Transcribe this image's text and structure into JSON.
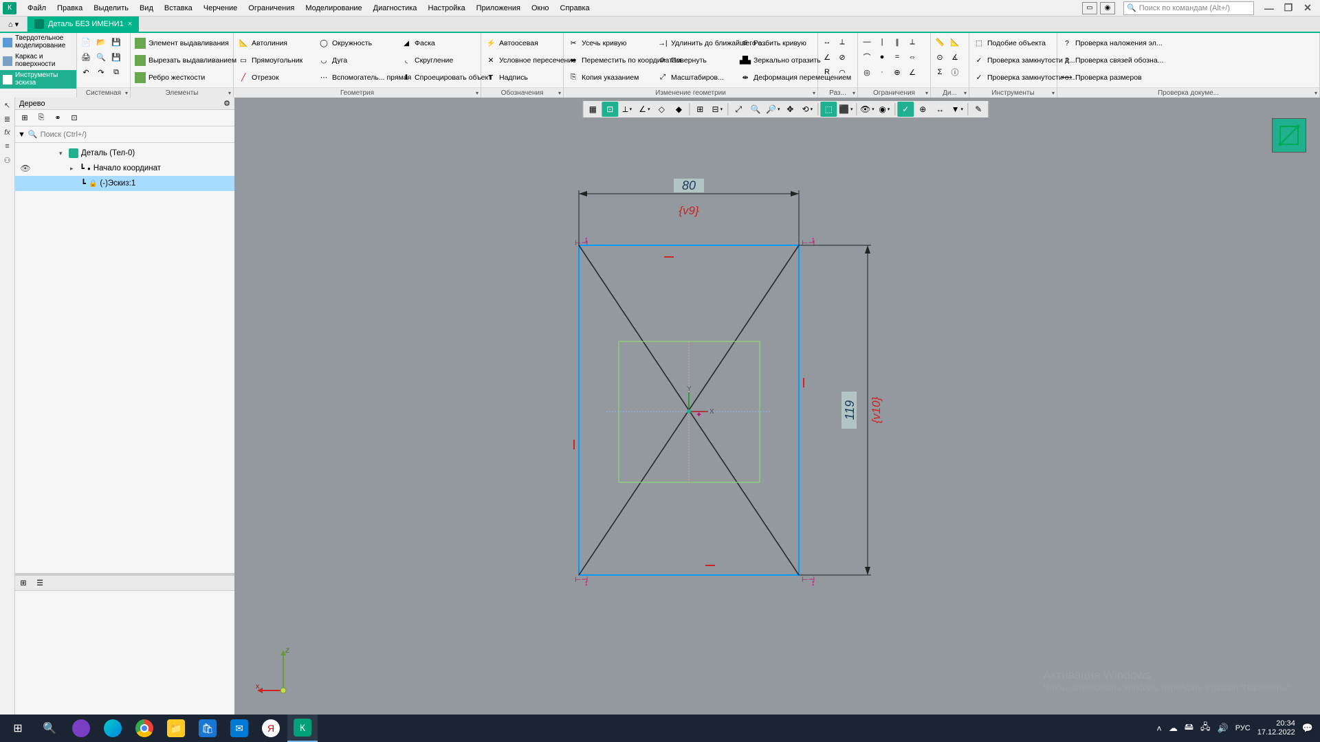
{
  "menu": [
    "Файл",
    "Правка",
    "Выделить",
    "Вид",
    "Вставка",
    "Черчение",
    "Ограничения",
    "Моделирование",
    "Диагностика",
    "Настройка",
    "Приложения",
    "Окно",
    "Справка"
  ],
  "search_placeholder": "Поиск по командам (Alt+/)",
  "tab": {
    "home": "⌂ ▾",
    "doc_name": "Деталь БЕЗ ИМЕНИ1"
  },
  "modes": [
    {
      "label": "Твердотельное моделирование"
    },
    {
      "label": "Каркас и поверхности"
    },
    {
      "label": "Инструменты эскиза",
      "active": true
    }
  ],
  "ribbon": {
    "system": {
      "label": "Системная"
    },
    "elements": {
      "label": "Элементы",
      "items": [
        "Элемент выдавливания",
        "Вырезать выдавливанием",
        "Ребро жесткости"
      ]
    },
    "geometry": {
      "label": "Геометрия",
      "col1": [
        "Автолиния",
        "Прямоугольник",
        "Отрезок"
      ],
      "col2": [
        "Окружность",
        "Дуга",
        "Вспомогатель... прямая"
      ],
      "col3": [
        "Фаска",
        "Скругление",
        "Спроецировать объект"
      ]
    },
    "annotate": {
      "label": "Обозначения",
      "items": [
        "Автоосевая",
        "Условное пересечение",
        "Надпись"
      ]
    },
    "edit_geom": {
      "label": "Изменение геометрии",
      "col1": [
        "Усечь кривую",
        "Переместить по координатам",
        "Копия указанием"
      ],
      "col2": [
        "Удлинить до ближайшего о...",
        "Повернуть",
        "Масштабиров..."
      ],
      "col3": [
        "Разбить кривую",
        "Зеркально отразить",
        "Деформация перемещением"
      ]
    },
    "dims": {
      "label": "Раз..."
    },
    "constraints": {
      "label": "Ограничения"
    },
    "diag": {
      "label": "Ди..."
    },
    "tools": {
      "label": "Инструменты",
      "items": [
        "Подобие объекта",
        "Проверка замкнутости д...",
        "Проверка замкнутости о..."
      ]
    },
    "check": {
      "label": "Проверка докуме...",
      "items": [
        "Проверка наложения эл...",
        "Проверка связей обозна...",
        "Проверка размеров"
      ]
    }
  },
  "tree_panel": {
    "title": "Дерево",
    "search_placeholder": "Поиск (Ctrl+/)",
    "root": "Деталь (Тел-0)",
    "origin": "Начало координат",
    "sketch": "(-)Эскиз:1"
  },
  "sketch": {
    "dim_h": "80",
    "var_h": "{v9}",
    "dim_v": "119",
    "var_v": "{v10}",
    "x": "X",
    "y": "Y",
    "z": "Z",
    "axis_x_lower": "x"
  },
  "watermark": {
    "l1": "Активация Windows",
    "l2": "Чтобы активировать Windows, перейдите в раздел \"Параметры\"."
  },
  "tray": {
    "lang": "РУС",
    "time": "20:34",
    "date": "17.12.2022"
  }
}
